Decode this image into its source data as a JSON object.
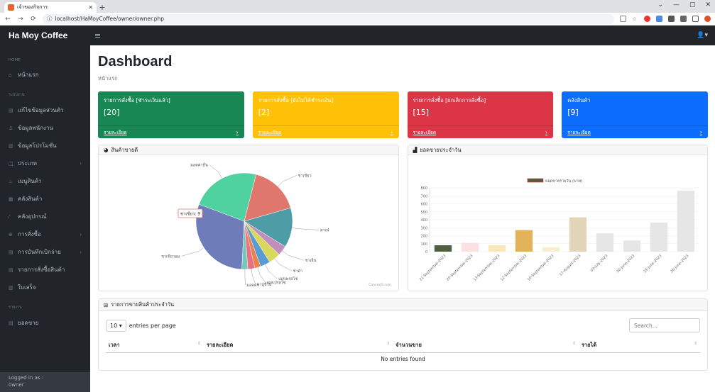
{
  "browser": {
    "tab_title": "เจ้าของกิจการ",
    "url": "localhost/HaMoyCoffee/owner/owner.php"
  },
  "brand": "Ha Moy Coffee",
  "sidebar": {
    "heading_home": "HOME",
    "heading_system": "ระบบงาน",
    "heading_report": "รายงาน",
    "items": [
      {
        "label": "หน้าแรก"
      },
      {
        "label": "แก้ไขข้อมูลส่วนตัว"
      },
      {
        "label": "ข้อมูลพนักงาน"
      },
      {
        "label": "ข้อมูลโปรโมชั่น"
      },
      {
        "label": "ประเภท"
      },
      {
        "label": "เมนูสินค้า"
      },
      {
        "label": "คลังสินค้า"
      },
      {
        "label": "คลังอุปกรณ์"
      },
      {
        "label": "การสั่งซื้อ"
      },
      {
        "label": "การบันทึกเบิกจ่าย"
      },
      {
        "label": "รายการสั่งซื้อสินค้า"
      },
      {
        "label": "ใบเสร็จ"
      },
      {
        "label": "ยอดขาย"
      }
    ],
    "footer_label": "Logged in as :",
    "footer_user": "owner"
  },
  "main": {
    "title": "Dashboard",
    "breadcrumb": "หน้าแรก"
  },
  "cards": [
    {
      "title": "รายการสั่งซื้อ [ชำระเงินแล้ว]",
      "value": "[20]",
      "link": "รายละเอียด",
      "color": "#198754"
    },
    {
      "title": "รายการสั่งซื้อ [ยังไม่ได้ชำระเงิน]",
      "value": "[2]",
      "link": "รายละเอียด",
      "color": "#ffc107"
    },
    {
      "title": "รายการสั่งซื้อ [ยกเลิกการสั่งซื้อ]",
      "value": "[15]",
      "link": "รายละเอียด",
      "color": "#dc3545"
    },
    {
      "title": "คลังสินค้า",
      "value": "[9]",
      "link": "รายละเอียด",
      "color": "#0d6efd"
    }
  ],
  "pie_panel": {
    "title": "สินค้าขายดี",
    "tooltip": "ชาเขียว: 9",
    "credit": "CanvasJS.com"
  },
  "bar_panel": {
    "title": "ยอดขายประจำวัน"
  },
  "chart_data": [
    {
      "type": "pie",
      "title": "สินค้าขายดี",
      "slices": [
        {
          "label": "ชาเขียวนม",
          "value": 9,
          "color": "#6f7cba"
        },
        {
          "label": "มอคค่าปั่น",
          "value": 7,
          "color": "#4fd1a0"
        },
        {
          "label": "ชาเขียว",
          "value": 5,
          "color": "#e0776c"
        },
        {
          "label": "คาเฟ่",
          "value": 4,
          "color": "#4e9ca6"
        },
        {
          "label": "ชาเย็น",
          "value": 1,
          "color": "#c28fbd"
        },
        {
          "label": "ชาดำ",
          "value": 1.2,
          "color": "#d8d85a"
        },
        {
          "label": "เอสเพรสโซ่",
          "value": 1,
          "color": "#5a9bd4"
        },
        {
          "label": "เอสเปรสโซ่",
          "value": 0.6,
          "color": "#e8834a"
        },
        {
          "label": "คาปูชิโน",
          "value": 0.7,
          "color": "#ea6f83"
        },
        {
          "label": "มอคค่า",
          "value": 0.6,
          "color": "#74c7bb"
        }
      ]
    },
    {
      "type": "bar",
      "title": "ยอดขายประจำวัน",
      "legend": "ยอดขายรายวัน (บาท)",
      "ylim": [
        0,
        800
      ],
      "yticks": [
        0,
        100,
        200,
        300,
        400,
        500,
        600,
        700,
        800
      ],
      "categories": [
        "21-September-2023",
        "20-September-2023",
        "13-September-2023",
        "12-September-2023",
        "10-September-2023",
        "17-August-2023",
        "03-July-2023",
        "30-June-2023",
        "29-June-2023",
        "26-June-2023"
      ],
      "values": [
        80,
        110,
        80,
        270,
        55,
        430,
        230,
        140,
        365,
        765
      ],
      "colors": [
        "#4f5f3f",
        "#fbe1e1",
        "#f9e7b8",
        "#e3b35c",
        "#fbedd0",
        "#e3d6b8",
        "#e6e6e6",
        "#e6e6e6",
        "#e6e6e6",
        "#e6e6e6"
      ]
    }
  ],
  "table_panel": {
    "title": "รายการขายสินค้าประจำวัน",
    "page_size": "10",
    "entries_label": "entries per page",
    "search_placeholder": "Search...",
    "columns": [
      "เวลา",
      "รายละเอียด",
      "จำนวนขาย",
      "รายได้"
    ],
    "empty": "No entries found"
  }
}
